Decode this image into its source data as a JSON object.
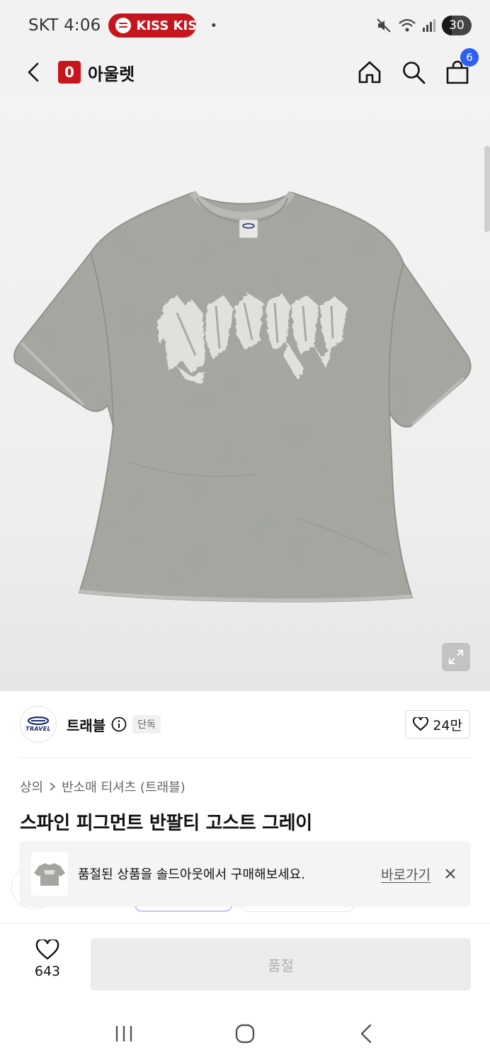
{
  "status_bar": {
    "carrier": "SKT",
    "time": "4:06",
    "now_playing": "KISS KIS",
    "battery": "30"
  },
  "header": {
    "logo_text": "0",
    "title": "아울렛",
    "cart_count": "6"
  },
  "brand": {
    "avatar_text": "TRAVEL",
    "name": "트래블",
    "tag": "단독",
    "likes": "24만"
  },
  "product": {
    "breadcrumb": [
      "상의",
      "반소매 티셔츠 (트래블)"
    ],
    "title": "스파인 피그먼트 반팔티 고스트 그레이"
  },
  "soldout_banner": {
    "message": "품절된 상품을 솔드아웃에서 구매해보세요.",
    "link_label": "바로가기"
  },
  "bottom_bar": {
    "wish_count": "643",
    "action_label": "품절"
  },
  "colors": {
    "accent_red": "#c8151b",
    "badge_blue": "#2c5ff6",
    "shirt_gray": "#a3a59f"
  },
  "icons": [
    "back-icon",
    "home-icon",
    "search-icon",
    "cart-icon",
    "expand-icon",
    "info-icon",
    "heart-icon",
    "close-icon",
    "recents-icon",
    "home-nav-icon",
    "back-nav-icon"
  ]
}
